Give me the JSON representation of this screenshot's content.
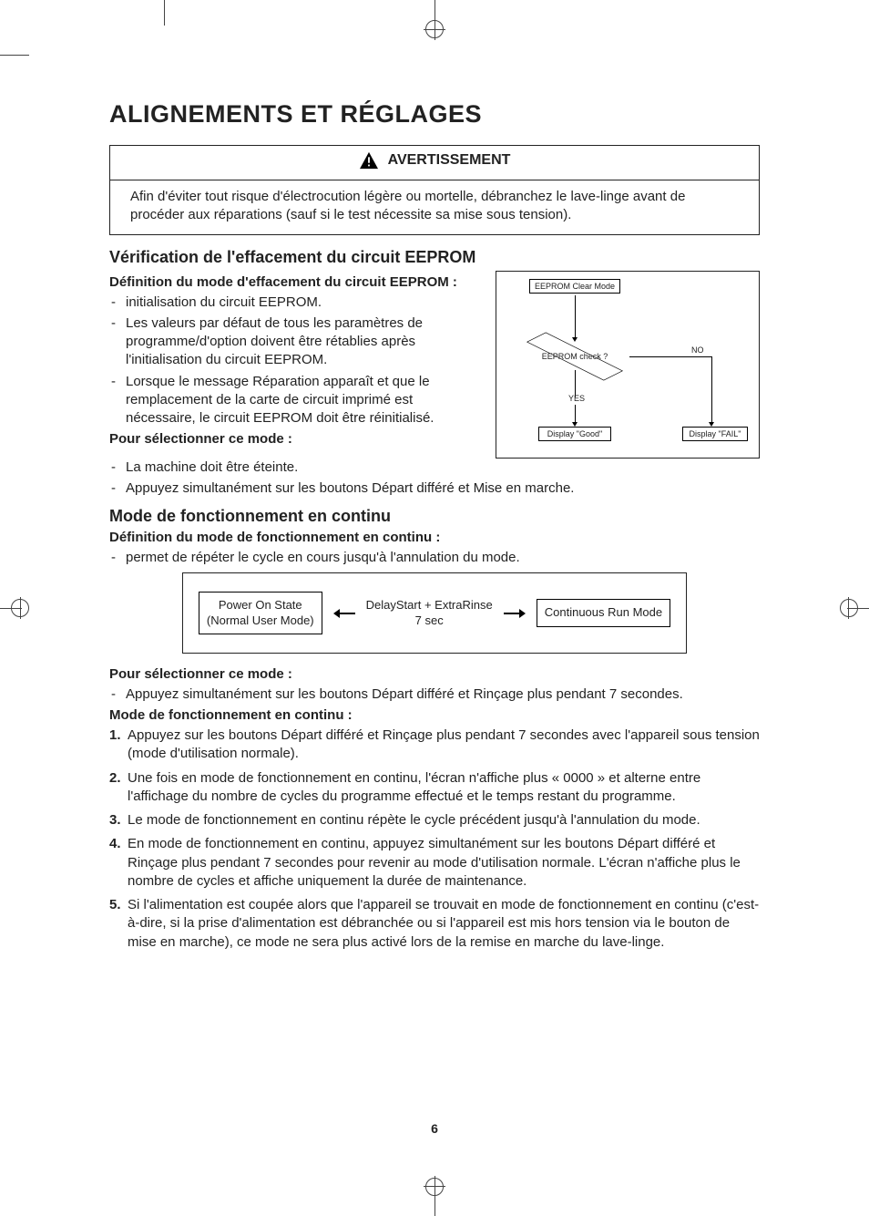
{
  "page_title": "ALIGNEMENTS ET RÉGLAGES",
  "page_number": "6",
  "warning": {
    "heading": "AVERTISSEMENT",
    "body": "Afin d'éviter tout risque d'électrocution légère ou mortelle, débranchez le lave-linge avant de procéder aux réparations (sauf si le test nécessite sa mise sous tension)."
  },
  "eeprom": {
    "heading": "Vérification de l'effacement du circuit EEPROM",
    "def_heading": "Définition du mode d'effacement du circuit EEPROM :",
    "def_items": [
      "initialisation du circuit EEPROM.",
      "Les valeurs par défaut de tous les paramètres de programme/d'option doivent être rétablies après l'initialisation du circuit EEPROM.",
      "Lorsque le message Réparation apparaît et que le remplacement de la carte de circuit imprimé est nécessaire, le circuit EEPROM doit être réinitialisé."
    ],
    "select_heading": "Pour sélectionner ce mode :",
    "select_items": [
      "La machine doit être éteinte.",
      "Appuyez simultanément sur les boutons Départ différé et Mise en marche."
    ],
    "flow": {
      "start": "EEPROM Clear Mode",
      "decision": "EEPROM check ?",
      "yes": "YES",
      "no": "NO",
      "good": "Display \"Good\"",
      "fail": "Display \"FAIL\""
    }
  },
  "continuous": {
    "heading": "Mode de fonctionnement en continu",
    "def_heading": "Définition du mode de fonctionnement en continu :",
    "def_items": [
      "permet de répéter le cycle en cours jusqu'à l'annulation du mode."
    ],
    "diagram": {
      "left_line1": "Power On State",
      "left_line2": "(Normal User Mode)",
      "mid_line1": "DelayStart + ExtraRinse",
      "mid_line2": "7 sec",
      "right": "Continuous Run Mode"
    },
    "select_heading": "Pour sélectionner ce mode :",
    "select_items": [
      "Appuyez simultanément sur les boutons Départ différé et Rinçage plus pendant 7 secondes."
    ],
    "mode_heading": "Mode de fonctionnement en continu :",
    "steps": [
      "Appuyez sur les boutons Départ différé et Rinçage plus pendant 7 secondes avec l'appareil sous tension (mode d'utilisation normale).",
      "Une fois en mode de fonctionnement en continu, l'écran n'affiche plus « 0000 » et alterne entre l'affichage du nombre de cycles du programme effectué et le temps restant du programme.",
      "Le mode de fonctionnement en continu répète le cycle précédent jusqu'à l'annulation du mode.",
      "En mode de fonctionnement en continu, appuyez simultanément sur les boutons Départ différé et Rinçage plus pendant 7 secondes pour revenir au mode d'utilisation normale. L'écran n'affiche plus le nombre de cycles et affiche uniquement la durée de maintenance.",
      "Si l'alimentation est coupée alors que l'appareil se trouvait en mode de fonctionnement en continu (c'est-à-dire, si la prise d'alimentation est débranchée ou si l'appareil est mis hors tension via le bouton de mise en marche), ce mode ne sera plus activé lors de la remise en marche du lave-linge."
    ]
  }
}
